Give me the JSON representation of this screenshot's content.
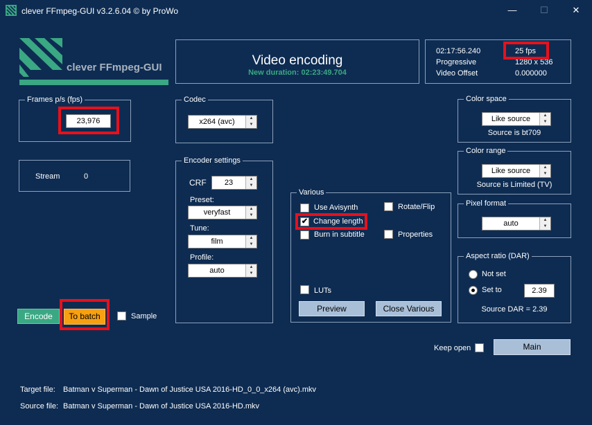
{
  "window": {
    "title": "clever FFmpeg-GUI v3.2.6.04   © by ProWo",
    "minimize_glyph": "—",
    "maximize_glyph": "☐",
    "close_glyph": "✕"
  },
  "logo": {
    "text": "clever FFmpeg-GUI"
  },
  "header": {
    "title": "Video encoding",
    "subtitle": "New duration: 02:23:49.704"
  },
  "info": {
    "duration": "02:17:56.240",
    "fps": "25 fps",
    "scan": "Progressive",
    "resolution": "1280 x 536",
    "offset_label": "Video Offset",
    "offset_value": "0.000000"
  },
  "fps_box": {
    "label": "Frames p/s (fps)",
    "value": "23,976"
  },
  "stream_box": {
    "label": "Stream",
    "value": "0"
  },
  "codec": {
    "label": "Codec",
    "value": "x264 (avc)"
  },
  "encoder": {
    "label": "Encoder settings",
    "crf_label": "CRF",
    "crf_value": "23",
    "preset_label": "Preset:",
    "preset_value": "veryfast",
    "tune_label": "Tune:",
    "tune_value": "film",
    "profile_label": "Profile:",
    "profile_value": "auto"
  },
  "various": {
    "label": "Various",
    "use_avisynth": "Use Avisynth",
    "rotate_flip": "Rotate/Flip",
    "change_length": "Change length",
    "burn_subtitle": "Burn in subtitle",
    "properties": "Properties",
    "luts": "LUTs",
    "preview": "Preview",
    "close_various": "Close Various"
  },
  "color_space": {
    "label": "Color space",
    "value": "Like source",
    "source": "Source is bt709"
  },
  "color_range": {
    "label": "Color range",
    "value": "Like source",
    "source": "Source is Limited (TV)"
  },
  "pixel_format": {
    "label": "Pixel format",
    "value": "auto"
  },
  "aspect": {
    "label": "Aspect ratio (DAR)",
    "not_set": "Not set",
    "set_to": "Set to",
    "value": "2.39",
    "source": "Source DAR = 2.39"
  },
  "actions": {
    "encode": "Encode",
    "to_batch": "To batch",
    "sample": "Sample",
    "keep_open": "Keep open",
    "main": "Main"
  },
  "files": {
    "target_label": "Target file:",
    "target_value": "Batman v Superman - Dawn of Justice USA 2016-HD_0_0_x264 (avc).mkv",
    "source_label": "Source file:",
    "source_value": "Batman v Superman - Dawn of Justice USA 2016-HD.mkv"
  },
  "colors": {
    "background": "#0e2c52",
    "accent_green": "#3aa883",
    "accent_orange": "#f7a010",
    "highlight_red": "#e8101b",
    "button_gray": "#a9bfd8"
  },
  "spin_up": "▲",
  "spin_down": "▼",
  "check": "✔"
}
